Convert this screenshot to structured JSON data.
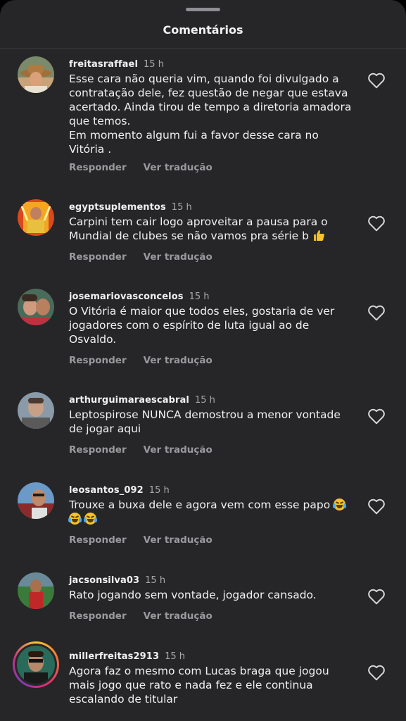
{
  "sheet": {
    "title": "Comentários"
  },
  "labels": {
    "reply": "Responder",
    "translate": "Ver tradução"
  },
  "comments": [
    {
      "username": "freitasraffael",
      "time": "15 h",
      "lines": [
        "Esse cara não queria vim, quando foi divulgado a contratação dele, fez questão de negar que estava acertado. Ainda tirou de tempo a diretoria amadora que temos.",
        "Em momento algum fui a favor desse cara no Vitória ."
      ]
    },
    {
      "username": "egyptsuplementos",
      "time": "15 h",
      "lines": [
        "Carpini tem cair logo aproveitar a pausa para o Mundial de clubes se não vamos pra série b"
      ],
      "emoji": "thumbs-up"
    },
    {
      "username": "josemariovasconcelos",
      "time": "15 h",
      "lines": [
        "O Vitória é maior que todos eles, gostaria de ver jogadores com o espírito de luta igual ao de Osvaldo."
      ]
    },
    {
      "username": "arthurguimaraescabral",
      "time": "15 h",
      "lines": [
        "Leptospirose NUNCA demostrou a menor vontade de jogar aqui"
      ]
    },
    {
      "username": "leosantos_092",
      "time": "15 h",
      "lines": [
        "Trouxe a buxa dele e agora vem com esse papo"
      ],
      "emoji": "face-with-tears-of-joy x3"
    },
    {
      "username": "jacsonsilva03",
      "time": "15 h",
      "lines": [
        "Rato jogando sem vontade, jogador cansado."
      ]
    },
    {
      "username": "millerfreitas2913",
      "time": "15 h",
      "lines": [
        "Agora faz o mesmo com Lucas braga que jogou mais jogo que rato e nada fez e ele continua escalando de titular"
      ]
    }
  ],
  "icons": {
    "like": "heart-outline-icon"
  },
  "colors": {
    "background": "#262628",
    "text": "#f0f0f0",
    "muted": "#9a9a9e"
  }
}
